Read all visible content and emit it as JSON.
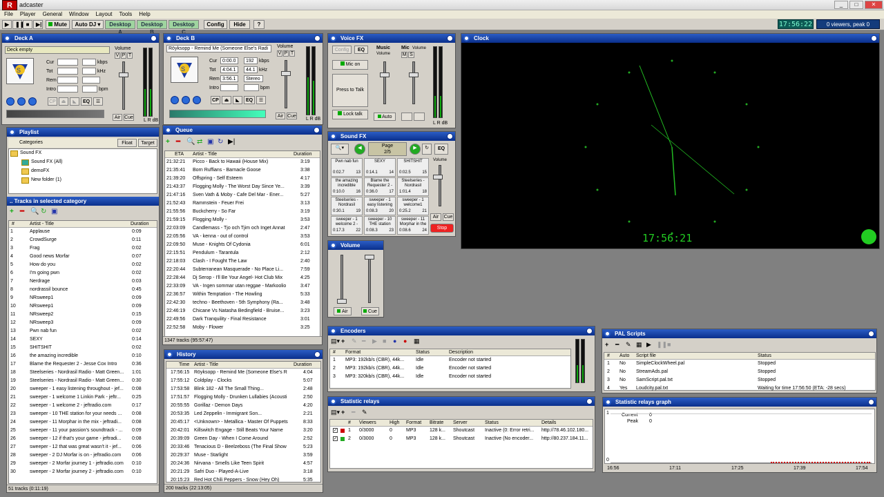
{
  "app": {
    "title": "adcaster",
    "logo": "R",
    "clock": "17:56:22",
    "viewers": "0 viewers, peak 0"
  },
  "menu": [
    "File",
    "Player",
    "General",
    "Window",
    "Layout",
    "Tools",
    "Help"
  ],
  "toolbar": {
    "mute": "Mute",
    "autodj": "Auto DJ",
    "desktopA": "Desktop A",
    "desktopB": "Desktop B",
    "desktopC": "Desktop C",
    "config": "Config",
    "hide": "Hide",
    "help": "?"
  },
  "deckA": {
    "title": "Deck A",
    "track": "Deck empty",
    "volume": "Volume",
    "v": "V",
    "p": "P",
    "t": "T",
    "cur": "Cur",
    "tot": "Tot",
    "rem": "Rem",
    "intro": "Intro",
    "kbps": "kbps",
    "khz": "kHz",
    "bpm": "bpm",
    "eq": "EQ",
    "air": "Air",
    "cue": "Cue",
    "lrdb": "L R dB"
  },
  "deckB": {
    "title": "Deck B",
    "track": "Röyksopp - Remind Me (Someone Else's Radi",
    "cur_val": "0:00.0",
    "tot_val": "4:04.1",
    "rem_val": "3:56.1",
    "kbps_val": "192",
    "khz_val": "44.1",
    "stereo": "Stereo",
    "cur": "Cur",
    "tot": "Tot",
    "rem": "Rem",
    "intro": "Intro",
    "bpm": "bpm",
    "kbps": "kbps",
    "khz": "kHz",
    "cp": "CP",
    "eq": "EQ",
    "volume": "Volume",
    "v": "V",
    "p": "P",
    "t": "T",
    "air": "Air",
    "cue": "Cue",
    "lrdb": "L R dB"
  },
  "voicefx": {
    "title": "Voice FX",
    "config": "Config",
    "eq": "EQ",
    "music": "Music",
    "mic": "Mic",
    "volume": "Volume",
    "m": "M",
    "s": "S",
    "micon": "Mic on",
    "ptt": "Press to Talk",
    "locktalk": "Lock talk",
    "auto": "Auto",
    "lrdb": "L R dB"
  },
  "soundfx": {
    "title": "Sound FX",
    "page_label": "Page",
    "page": "2/5",
    "eq": "EQ",
    "volume": "Volume",
    "air": "Air",
    "cue": "Cue",
    "stop": "Stop",
    "cells": [
      {
        "name": "Pwn nab fun",
        "dur": "0:02.7",
        "num": "13"
      },
      {
        "name": "SEXY",
        "dur": "0:14.1",
        "num": "14"
      },
      {
        "name": "SHITSHIT",
        "dur": "0:02.5",
        "num": "15"
      },
      {
        "name": "the amazing incredible",
        "dur": "0:10.0",
        "num": "16"
      },
      {
        "name": "Blame the Requester 2 -",
        "dur": "0:36.0",
        "num": "17"
      },
      {
        "name": "Steelseries - Nordrasil",
        "dur": "1:01.4",
        "num": "18"
      },
      {
        "name": "Steelseries - Nordrasil",
        "dur": "0:30.1",
        "num": "19"
      },
      {
        "name": "sweeper - 1 easy listening",
        "dur": "0:08.3",
        "num": "20"
      },
      {
        "name": "sweeper - 1 welcome1",
        "dur": "0:25.2",
        "num": "21"
      },
      {
        "name": "sweeper - 1 welcome 2 -",
        "dur": "0:17.3",
        "num": "22"
      },
      {
        "name": "sweeper - 10 THE station",
        "dur": "0:08.3",
        "num": "23"
      },
      {
        "name": "sweeper - 11 Morphar in the",
        "dur": "0:08.6",
        "num": "24"
      }
    ]
  },
  "volume": {
    "title": "Volume",
    "air": "Air",
    "cue": "Cue"
  },
  "clock": {
    "title": "Clock",
    "digital": "17:56:21"
  },
  "playlist": {
    "title": "Playlist",
    "categories": "Categories",
    "float": "Float",
    "target": "Target",
    "tree": [
      "Sound FX",
      "Sound FX (All)",
      "demoFX",
      "New folder (1)"
    ],
    "tracks_title": ".. Tracks in selected category",
    "col_title": "Artist - Title",
    "col_dur": "Duration",
    "tracks": [
      [
        "1",
        "Applause",
        "0:09"
      ],
      [
        "2",
        "CrowdSurge",
        "0:11"
      ],
      [
        "3",
        "Frag",
        "0:02"
      ],
      [
        "4",
        "Good news Morfar",
        "0:07"
      ],
      [
        "5",
        "How do you",
        "0:02"
      ],
      [
        "6",
        "I'm going pwn",
        "0:02"
      ],
      [
        "7",
        "Nerdrage",
        "0:03"
      ],
      [
        "8",
        "nordrassil bounce",
        "0:45"
      ],
      [
        "9",
        "NRsweep1",
        "0:09"
      ],
      [
        "10",
        "NRsweep1",
        "0:09"
      ],
      [
        "11",
        "NRsweep2",
        "0:15"
      ],
      [
        "12",
        "NRsweep3",
        "0:09"
      ],
      [
        "13",
        "Pwn nab fun",
        "0:02"
      ],
      [
        "14",
        "SEXY",
        "0:14"
      ],
      [
        "15",
        "SHITSHIT",
        "0:02"
      ],
      [
        "16",
        "the amazing incredible",
        "0:10"
      ],
      [
        "17",
        "Blame the Requester 2 - Jesse Cox Intro",
        "0:36"
      ],
      [
        "18",
        "Steelseries - Nordrasil Radio - Matt Green...",
        "1:01"
      ],
      [
        "19",
        "Steelseries - Nordrasil Radio - Matt Green...",
        "0:30"
      ],
      [
        "20",
        "sweeper - 1 easy listening throughout - jef...",
        "0:08"
      ],
      [
        "21",
        "sweeper - 1 welcome 1 Linkin Park - jeftr...",
        "0:25"
      ],
      [
        "22",
        "sweeper - 1 welcome 2 - jeftradio.com",
        "0:17"
      ],
      [
        "23",
        "sweeper - 10 THE station for your needs ...",
        "0:08"
      ],
      [
        "24",
        "sweeper - 11 Morphar in the mix - jeftradi...",
        "0:08"
      ],
      [
        "25",
        "sweeper - 11 your passion's soundtrack - ...",
        "0:09"
      ],
      [
        "26",
        "sweeper - 12 if that's your game - jeftradi...",
        "0:08"
      ],
      [
        "27",
        "sweeper - 12 that was great wasn't it - jef...",
        "0:06"
      ],
      [
        "28",
        "sweeper - 2 DJ Morfar is on - jeftradio.com",
        "0:06"
      ],
      [
        "29",
        "sweeper - 2 Morfar journey 1 - jeftradio.com",
        "0:10"
      ],
      [
        "30",
        "sweeper - 2 Morfar journey 2 - jeftradio.com",
        "0:10"
      ]
    ],
    "status": "51 tracks (0:11:19)"
  },
  "queue": {
    "title": "Queue",
    "col_eta": "ETA",
    "col_title": "Artist - Title",
    "col_dur": "Duration",
    "rows": [
      [
        "21:32:21",
        "Picco - Back to Hawaii (House Mix)",
        "3:19"
      ],
      [
        "21:35:41",
        "Born Ruffians - Barnacle Goose",
        "3:38"
      ],
      [
        "21:39:20",
        "Offspring - Self Esteem",
        "4:17"
      ],
      [
        "21:43:37",
        "Flogging Molly - The Worst Day Since Ye...",
        "3:39"
      ],
      [
        "21:47:16",
        "Sven Vath & Moby - Cafe Del Mar - Ener...",
        "5:27"
      ],
      [
        "21:52:43",
        "Rammstein - Feuer Frei",
        "3:13"
      ],
      [
        "21:55:56",
        "Buckcherry - So Far",
        "3:19"
      ],
      [
        "21:59:15",
        "Flogging Molly -",
        "3:53"
      ],
      [
        "22:03:09",
        "Candlemass - Tjo och Tjim och Inget Annat",
        "2:47"
      ],
      [
        "22:05:56",
        "VA - kenna - out of control",
        "3:53"
      ],
      [
        "22:09:50",
        "Muse - Knights Of Cydonia",
        "6:01"
      ],
      [
        "22:15:51",
        "Pendulum - Tarantula",
        "2:12"
      ],
      [
        "22:18:03",
        "Clash - I Fought The Law",
        "2:40"
      ],
      [
        "22:20:44",
        "Subterranean Masquerade - No Place Li...",
        "7:59"
      ],
      [
        "22:28:44",
        "Dj Serop - I'll Be Your Angel- Hot Club Mix",
        "4:25"
      ],
      [
        "22:33:09",
        "VA - Ingen sommar utan reggae - Markoolio",
        "3:47"
      ],
      [
        "22:36:57",
        "Within Temptation - The Howling",
        "5:33"
      ],
      [
        "22:42:30",
        "techno - Beethoven - 5th Symphony (Ra...",
        "3:48"
      ],
      [
        "22:46:19",
        "Chicane Vs Natasha Bedingfield - Bruise...",
        "3:23"
      ],
      [
        "22:49:56",
        "Dark Tranquility - Final Resistance",
        "3:01"
      ],
      [
        "22:52:58",
        "Moby - Flower",
        "3:25"
      ]
    ],
    "status": "1347 tracks (95:57:47)"
  },
  "history": {
    "title": "History",
    "col_time": "Time",
    "col_title": "Artist - Title",
    "col_dur": "Duration",
    "rows": [
      [
        "17:56:15",
        "Röyksopp - Remind Me (Someone Else's R",
        "4:04"
      ],
      [
        "17:55:12",
        "Coldplay - Clocks",
        "5:07"
      ],
      [
        "17:53:58",
        "Blink 182 - All The Small Thing...",
        "2:48"
      ],
      [
        "17:51:57",
        "Flogging Molly - Drunken Lullabies (Acousti",
        "2:50"
      ],
      [
        "20:55:55",
        "Gorillaz - Demon Days",
        "4:20"
      ],
      [
        "20:53:35",
        "Led Zeppelin - Immigrant Son...",
        "2:21"
      ],
      [
        "20:45:17",
        "<Unknown> - Metallica - Master Of Puppets",
        "8:33"
      ],
      [
        "20:42:01",
        "Killswitch Engage - Still Beats Your Name",
        "3:20"
      ],
      [
        "20:39:09",
        "Green Day - When I Come Around",
        "2:52"
      ],
      [
        "20:33:46",
        "Tenacious D - Beelzeboss (The Final Show",
        "5:23"
      ],
      [
        "20:29:37",
        "Muse - Starlight",
        "3:59"
      ],
      [
        "20:24:36",
        "Nirvana - Smells Like Teen Spirit",
        "4:57"
      ],
      [
        "20:21:29",
        "Safri Duo - Played-A-Live",
        "3:18"
      ],
      [
        "20:15:23",
        "Red Hot Chili Peppers - Snow (Hey Oh)",
        "5:35"
      ]
    ],
    "status": "200 tracks (22:13:05)"
  },
  "encoders": {
    "title": "Encoders",
    "col_num": "#",
    "col_format": "Format",
    "col_status": "Status",
    "col_desc": "Description",
    "rows": [
      [
        "1",
        "MP3: 192kb/s (CBR), 44k...",
        "Idle",
        "Encoder not started"
      ],
      [
        "2",
        "MP3: 192kb/s (CBR), 44k...",
        "Idle",
        "Encoder not started"
      ],
      [
        "3",
        "MP3: 320kb/s (CBR), 44k...",
        "Idle",
        "Encoder not started"
      ]
    ]
  },
  "pal": {
    "title": "PAL Scripts",
    "col_num": "#",
    "col_auto": "Auto",
    "col_file": "Script file",
    "col_status": "Status",
    "rows": [
      [
        "1",
        "No",
        "SimpleClockWheel.pal",
        "Stopped"
      ],
      [
        "2",
        "No",
        "StreamAds.pal",
        "Stopped"
      ],
      [
        "3",
        "No",
        "SamScript.pal.txt",
        "Stopped"
      ],
      [
        "4",
        "Yes",
        "Loudcity.pal.txt",
        "Waiting for time 17:56:50 (ETA: -28 secs)"
      ]
    ]
  },
  "relays": {
    "title": "Statistic relays",
    "col_num": "#",
    "col_viewers": "Viewers",
    "col_high": "High",
    "col_format": "Format",
    "col_bitrate": "Bitrate",
    "col_server": "Server",
    "col_status": "Status",
    "col_details": "Details",
    "rows": [
      [
        "1",
        "0/3000",
        "0",
        "MP3",
        "128 k...",
        "Shoutcast",
        "Inactive (0: Error retri...",
        "http://78.46.102.180..."
      ],
      [
        "2",
        "0/3000",
        "0",
        "MP3",
        "128 k...",
        "Shoutcast",
        "Inactive (No encoder...",
        "http://80.237.184.11..."
      ]
    ]
  },
  "relaygraph": {
    "title": "Statistic relays graph",
    "current": "Current",
    "current_val": "0",
    "peak": "Peak",
    "peak_val": "0",
    "xticks": [
      "16:56",
      "17:11",
      "17:25",
      "17:39",
      "17:54"
    ],
    "yticks": [
      "1",
      "0"
    ]
  }
}
